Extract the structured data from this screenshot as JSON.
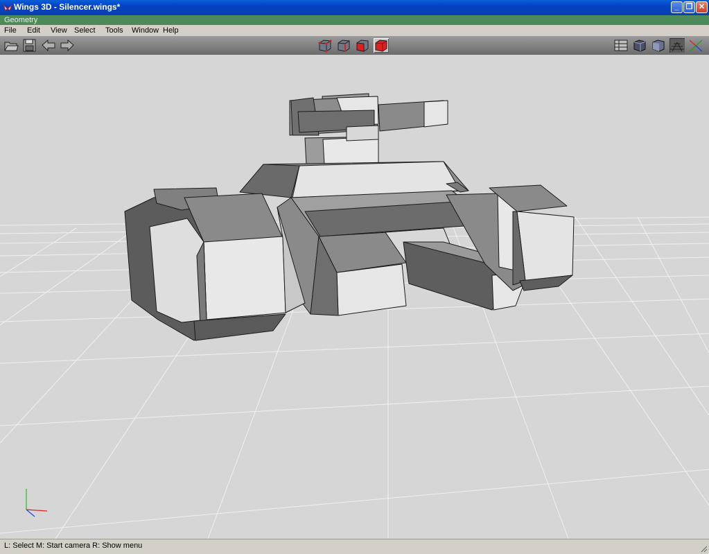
{
  "window": {
    "title": "Wings 3D - Silencer.wings*"
  },
  "geometry_tab": "Geometry",
  "menu": [
    "File",
    "Edit",
    "View",
    "Select",
    "Tools",
    "Window",
    "Help"
  ],
  "toolbar": {
    "left": [
      "open-icon",
      "save-icon",
      "undo-icon",
      "redo-icon"
    ],
    "selection_modes": [
      "vertex-mode-icon",
      "edge-mode-icon",
      "face-mode-icon",
      "body-mode-icon"
    ],
    "active_mode": "body-mode-icon",
    "right": [
      "workmode-icon",
      "smooth-shading-icon",
      "flat-shading-icon",
      "groundplane-icon",
      "axes-icon"
    ]
  },
  "colors": {
    "accent_active": "#e02020",
    "titlebar": "#0a3fae",
    "viewport_bg": "#d6d6d6"
  },
  "statusbar": {
    "text": "L: Select   M: Start camera   R: Show menu"
  }
}
